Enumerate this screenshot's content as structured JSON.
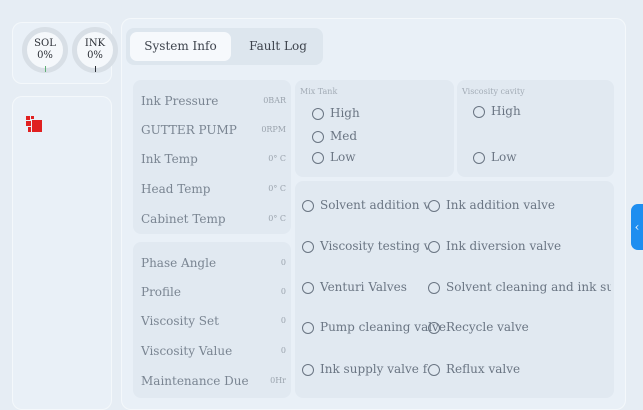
{
  "gauges": {
    "sol": {
      "label": "SOL",
      "value": "0%"
    },
    "ink": {
      "label": "INK",
      "value": "0%"
    }
  },
  "tabs": {
    "system_info": "System Info",
    "fault_log": "Fault Log",
    "selected": "System Info"
  },
  "status": {
    "rows": [
      {
        "label": "Ink Pressure",
        "value": "0BAR"
      },
      {
        "label": "GUTTER PUMP",
        "value": "0RPM"
      },
      {
        "label": "Ink Temp",
        "value": "0° C"
      },
      {
        "label": "Head Temp",
        "value": "0° C"
      },
      {
        "label": "Cabinet Temp",
        "value": "0° C"
      }
    ]
  },
  "params": {
    "rows": [
      {
        "label": "Phase Angle",
        "value": "0"
      },
      {
        "label": "Profile",
        "value": "0"
      },
      {
        "label": "Viscosity Set",
        "value": "0"
      },
      {
        "label": "Viscosity Value",
        "value": "0"
      },
      {
        "label": "Maintenance Due",
        "value": "0Hr"
      }
    ]
  },
  "mix_tank": {
    "title": "Mix Tank",
    "levels": [
      "High",
      "Med",
      "Low"
    ]
  },
  "viscosity_cavity": {
    "title": "Viscosity cavity",
    "levels": [
      "High",
      "Low"
    ]
  },
  "valves": [
    "Solvent addition val",
    "Ink addition valve",
    "Viscosity testing va",
    "Ink diversion valve",
    "Venturi Valves",
    "Solvent cleaning and ink suppl",
    "Pump cleaning valve",
    "Recycle valve",
    "Ink supply valve for",
    "Reflux valve"
  ],
  "side_handle": {
    "icon": "chevron-left-icon",
    "glyph": "‹",
    "color": "#1e8ef0"
  },
  "logo_icon": "brand-logo-icon"
}
